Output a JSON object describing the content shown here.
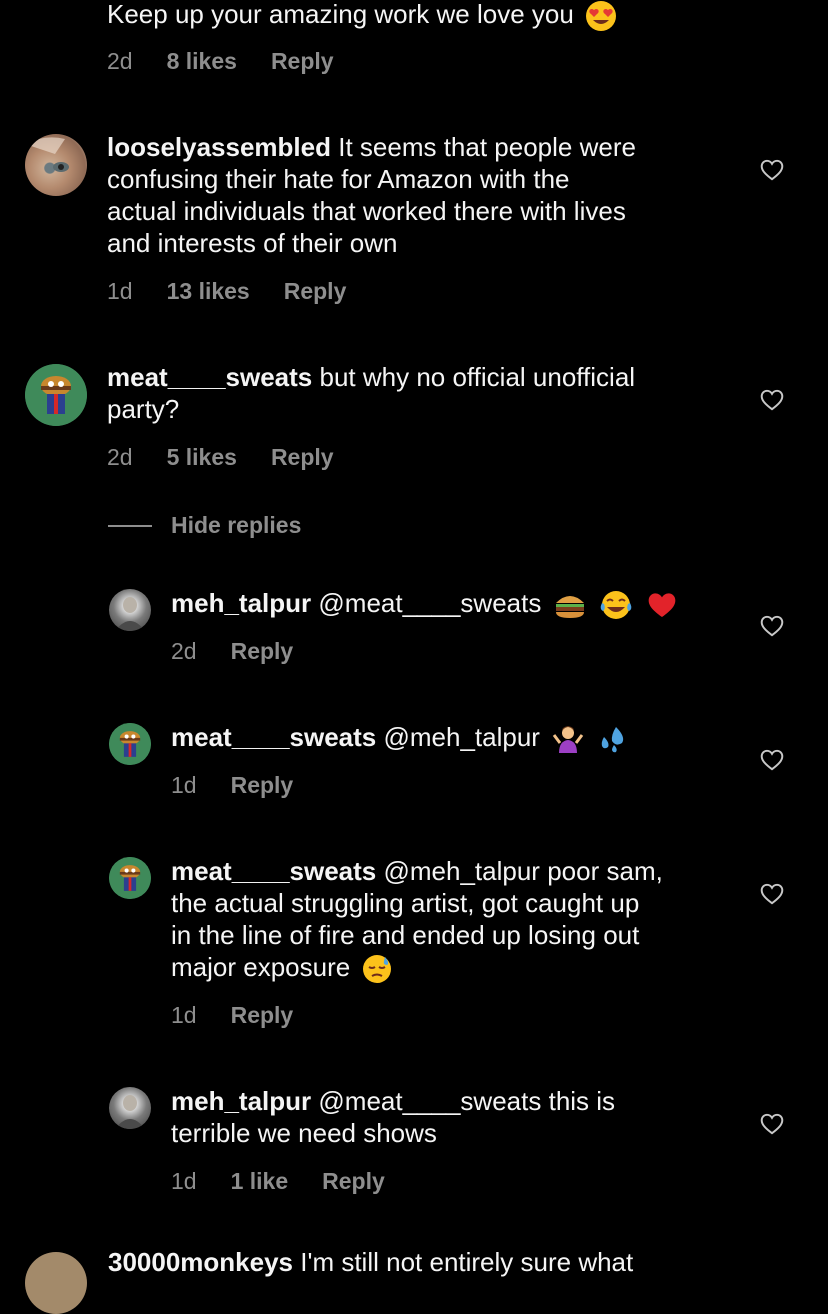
{
  "comments": [
    {
      "text": "Keep up your amazing work we love you",
      "time": "2d",
      "likes": "8 likes",
      "reply": "Reply"
    },
    {
      "username": "looselyassembled",
      "line1": "It seems that people were",
      "line2": "confusing their hate for Amazon with the",
      "line3": "actual individuals that worked there with lives",
      "line4": "and interests of their own",
      "time": "1d",
      "likes": "13 likes",
      "reply": "Reply"
    },
    {
      "username": "meat____sweats",
      "line1": "but why no official unofficial",
      "line2": "party?",
      "time": "2d",
      "likes": "5 likes",
      "reply": "Reply"
    }
  ],
  "hide_replies": "Hide replies",
  "replies": [
    {
      "username": "meh_talpur",
      "mention": "@meat____sweats",
      "time": "2d",
      "reply": "Reply"
    },
    {
      "username": "meat____sweats",
      "mention": "@meh_talpur",
      "time": "1d",
      "reply": "Reply"
    },
    {
      "username": "meat____sweats",
      "mention": "@meh_talpur",
      "line1": "poor sam,",
      "line2": "the actual struggling artist, got caught up",
      "line3": "in the line of fire and ended up losing out",
      "line4": "major exposure",
      "time": "1d",
      "reply": "Reply"
    },
    {
      "username": "meh_talpur",
      "mention": "@meat____sweats",
      "line1": "this is",
      "line2": "terrible we need shows",
      "time": "1d",
      "likes": "1 like",
      "reply": "Reply"
    }
  ],
  "next_comment_partial": {
    "username": "30000monkeys",
    "text": "I'm still not entirely sure what"
  },
  "colors": {
    "background": "#000000",
    "text": "#f5f5f5",
    "secondary": "#8e8e8e"
  },
  "icons": [
    "heart-outline-icon"
  ]
}
